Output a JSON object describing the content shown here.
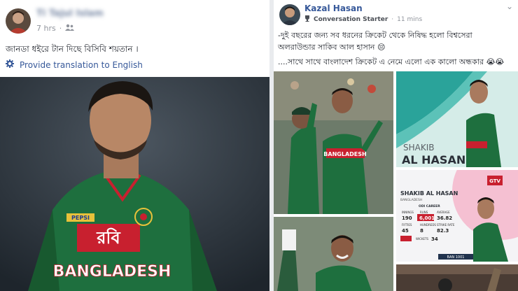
{
  "left_post": {
    "author_name": "Ti Tajul Islam",
    "time": "7 hrs",
    "privacy_icon": "friends-icon",
    "text": "জানডা ধইরে টান দিছে বিসিবি শয়তান ।",
    "translate_label": "Provide translation to English",
    "translate_icon": "gear-icon",
    "jersey_sponsor": "রবি",
    "jersey_country": "BANGLADESH",
    "brand_badge": "PEPSI"
  },
  "right_post": {
    "author_name": "Kazal Hasan",
    "badge_label": "Conversation Starter",
    "time": "11 mins",
    "line1": "-দুই বছরের জন্য সব ধরনের ক্রিকেট থেকে নিষিদ্ধ হলো বিশ্বসেরা অলরাউন্ডার সাকিব আল হাসান 😔",
    "line2": "....সাথে সাথে বাংলাদেশ ক্রিকেট এ নেমে এলো এক কালো অন্ধকার 😭😭",
    "tile_title_first": "SHAKIB",
    "tile_title_last": "AL HASAN",
    "jersey_text": "BANGLADESH",
    "card": {
      "name": "SHAKIB AL HASAN",
      "country": "BANGLADESH",
      "section": "ODI CAREER",
      "headers": [
        "INNINGS",
        "RUNS",
        "AVERAGE"
      ],
      "row1": [
        "190",
        "6,001",
        "36.82"
      ],
      "headers2": [
        "FIFTIES",
        "HUNDREDS",
        "STRIKE RATE"
      ],
      "row2": [
        "45",
        "8",
        "82.3"
      ],
      "wickets_label": "WICKETS",
      "wickets": "34",
      "channel": "GTV",
      "score": "BAN 1001"
    }
  },
  "colors": {
    "link": "#365899",
    "meta": "#90949c",
    "jersey_green": "#1e6f3e",
    "jersey_red": "#c8202f",
    "tile_teal": "#2aa39a"
  }
}
